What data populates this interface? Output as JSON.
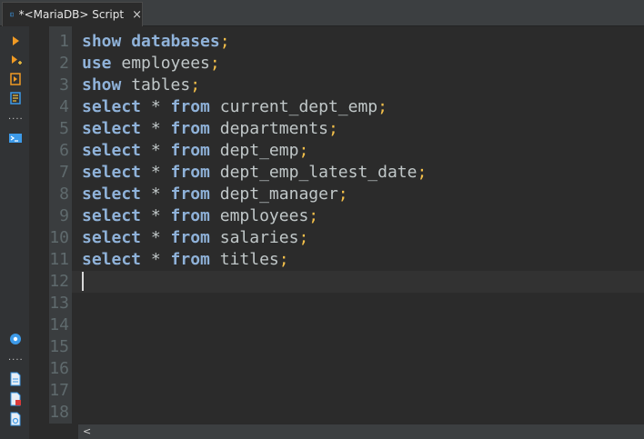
{
  "tab": {
    "title": "*<MariaDB> Script",
    "close_glyph": "×",
    "icon": "sql-script-icon"
  },
  "toolbar": {
    "icons": [
      "execute-statement-icon",
      "execute-script-icon",
      "execute-in-new-tab-icon",
      "explain-plan-icon",
      "more-dots-icon",
      "console-icon"
    ],
    "lower_icons": [
      "navigator-icon",
      "more-dots-icon",
      "new-script-icon",
      "delete-script-icon",
      "export-script-icon"
    ]
  },
  "editor": {
    "line_numbers": [
      "1",
      "2",
      "3",
      "4",
      "5",
      "6",
      "7",
      "8",
      "9",
      "10",
      "11",
      "12",
      "13",
      "14",
      "15",
      "16",
      "17",
      "18"
    ],
    "lines": [
      [
        {
          "t": "show",
          "c": "kw"
        },
        {
          "t": " ",
          "c": "id"
        },
        {
          "t": "databases",
          "c": "kw"
        },
        {
          "t": ";",
          "c": "semi"
        }
      ],
      [
        {
          "t": "use",
          "c": "kw"
        },
        {
          "t": " employees",
          "c": "id"
        },
        {
          "t": ";",
          "c": "semi"
        }
      ],
      [
        {
          "t": "show",
          "c": "kw"
        },
        {
          "t": " tables",
          "c": "id"
        },
        {
          "t": ";",
          "c": "semi"
        }
      ],
      [
        {
          "t": "select",
          "c": "kw"
        },
        {
          "t": " * ",
          "c": "op"
        },
        {
          "t": "from",
          "c": "kw"
        },
        {
          "t": " current_dept_emp",
          "c": "id"
        },
        {
          "t": ";",
          "c": "semi"
        }
      ],
      [
        {
          "t": "select",
          "c": "kw"
        },
        {
          "t": " * ",
          "c": "op"
        },
        {
          "t": "from",
          "c": "kw"
        },
        {
          "t": " departments",
          "c": "id"
        },
        {
          "t": ";",
          "c": "semi"
        }
      ],
      [
        {
          "t": "select",
          "c": "kw"
        },
        {
          "t": " * ",
          "c": "op"
        },
        {
          "t": "from",
          "c": "kw"
        },
        {
          "t": " dept_emp",
          "c": "id"
        },
        {
          "t": ";",
          "c": "semi"
        }
      ],
      [
        {
          "t": "select",
          "c": "kw"
        },
        {
          "t": " * ",
          "c": "op"
        },
        {
          "t": "from",
          "c": "kw"
        },
        {
          "t": " dept_emp_latest_date",
          "c": "id"
        },
        {
          "t": ";",
          "c": "semi"
        }
      ],
      [
        {
          "t": "select",
          "c": "kw"
        },
        {
          "t": " * ",
          "c": "op"
        },
        {
          "t": "from",
          "c": "kw"
        },
        {
          "t": " dept_manager",
          "c": "id"
        },
        {
          "t": ";",
          "c": "semi"
        }
      ],
      [
        {
          "t": "select",
          "c": "kw"
        },
        {
          "t": " * ",
          "c": "op"
        },
        {
          "t": "from",
          "c": "kw"
        },
        {
          "t": " employees",
          "c": "id"
        },
        {
          "t": ";",
          "c": "semi"
        }
      ],
      [
        {
          "t": "select",
          "c": "kw"
        },
        {
          "t": " * ",
          "c": "op"
        },
        {
          "t": "from",
          "c": "kw"
        },
        {
          "t": " salaries",
          "c": "id"
        },
        {
          "t": ";",
          "c": "semi"
        }
      ],
      [
        {
          "t": "select",
          "c": "kw"
        },
        {
          "t": " * ",
          "c": "op"
        },
        {
          "t": "from",
          "c": "kw"
        },
        {
          "t": " titles",
          "c": "id"
        },
        {
          "t": ";",
          "c": "semi"
        }
      ]
    ],
    "current_line": "12"
  },
  "scrollbar": {
    "left_arrow": "<"
  }
}
